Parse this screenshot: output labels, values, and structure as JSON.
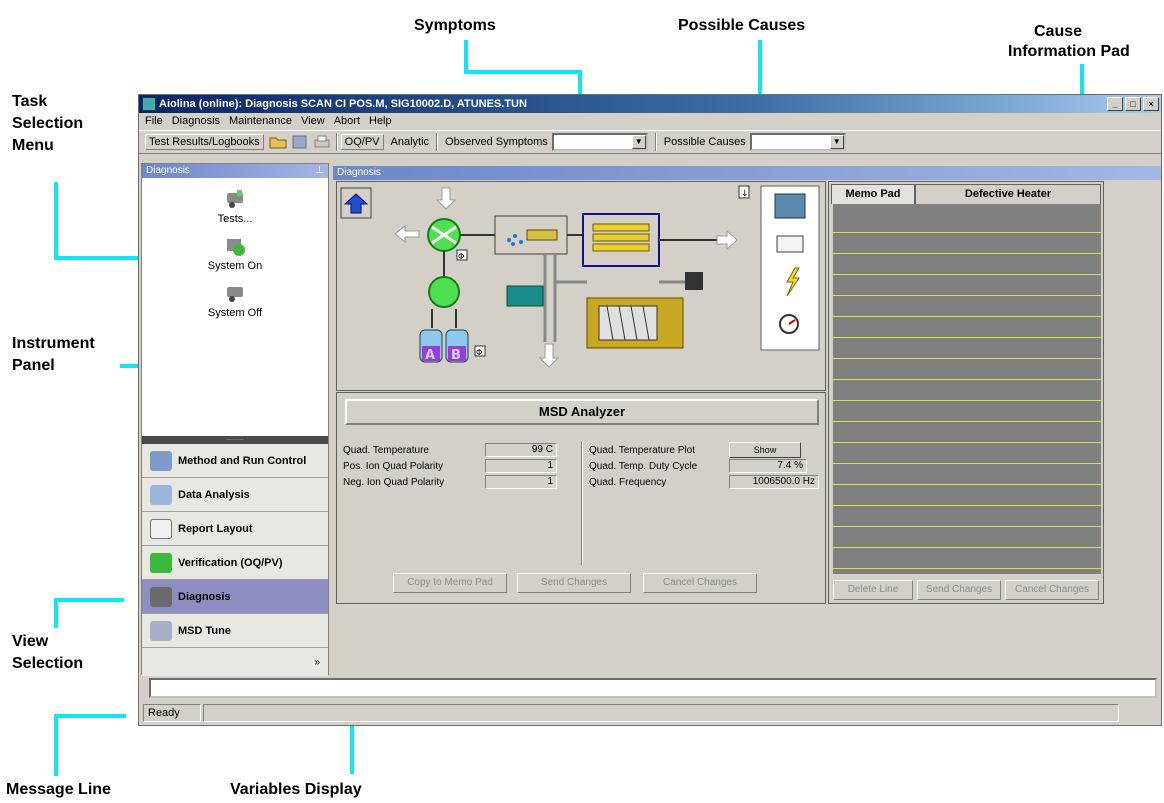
{
  "annotations": {
    "symptoms": "Symptoms",
    "possible_causes": "Possible Causes",
    "cause_info_1": "Cause",
    "cause_info_2": "Information Pad",
    "task_1": "Task",
    "task_2": "Selection",
    "task_3": "Menu",
    "instr_1": "Instrument",
    "instr_2": "Panel",
    "view_1": "View",
    "view_2": "Selection",
    "message_line": "Message Line",
    "variables_display": "Variables Display"
  },
  "window": {
    "title": "Aiolina (online): Diagnosis SCAN CI POS.M, SIG10002.D, ATUNES.TUN",
    "controls": [
      "_",
      "□",
      "×"
    ]
  },
  "menu": [
    "File",
    "Diagnosis",
    "Maintenance",
    "View",
    "Abort",
    "Help"
  ],
  "toolbar": {
    "test_results": "Test Results/Logbooks",
    "oqpv": "OQ/PV",
    "analytic": "Analytic",
    "observed_symptoms": "Observed Symptoms",
    "possible_causes": "Possible Causes",
    "icons": [
      "folder-open-icon",
      "save-icon",
      "print-icon"
    ]
  },
  "left_pane": {
    "header": "Diagnosis",
    "tasks": [
      "Tests...",
      "System On",
      "System Off"
    ],
    "views": [
      "Method and Run Control",
      "Data Analysis",
      "Report Layout",
      "Verification (OQ/PV)",
      "Diagnosis",
      "MSD Tune"
    ],
    "selected_view": "Diagnosis",
    "more": "»"
  },
  "diagnosis_header": "Diagnosis",
  "instrument": {
    "bottle_a": "A",
    "bottle_b": "B",
    "info_glyph": "Φ",
    "arrow_glyph": "↓"
  },
  "analyzer": {
    "title": "MSD Analyzer",
    "left_vars": [
      {
        "label": "Quad. Temperature",
        "value": "99 C"
      },
      {
        "label": "Pos. Ion Quad Polarity",
        "value": "1"
      },
      {
        "label": "Neg. Ion Quad Polarity",
        "value": "1"
      }
    ],
    "right_vars": [
      {
        "label": "Quad. Temperature Plot",
        "value": "Show"
      },
      {
        "label": "Quad. Temp. Duty Cycle",
        "value": "7.4 %"
      },
      {
        "label": "Quad. Frequency",
        "value": "1006500.0 Hz"
      }
    ],
    "buttons": [
      "Copy to Memo Pad",
      "Send Changes",
      "Cancel Changes"
    ]
  },
  "memo": {
    "tabs": [
      "Memo Pad",
      "Defective Heater"
    ],
    "buttons": [
      "Delete Line",
      "Send Changes",
      "Cancel Changes"
    ]
  },
  "status": {
    "ready": "Ready"
  }
}
